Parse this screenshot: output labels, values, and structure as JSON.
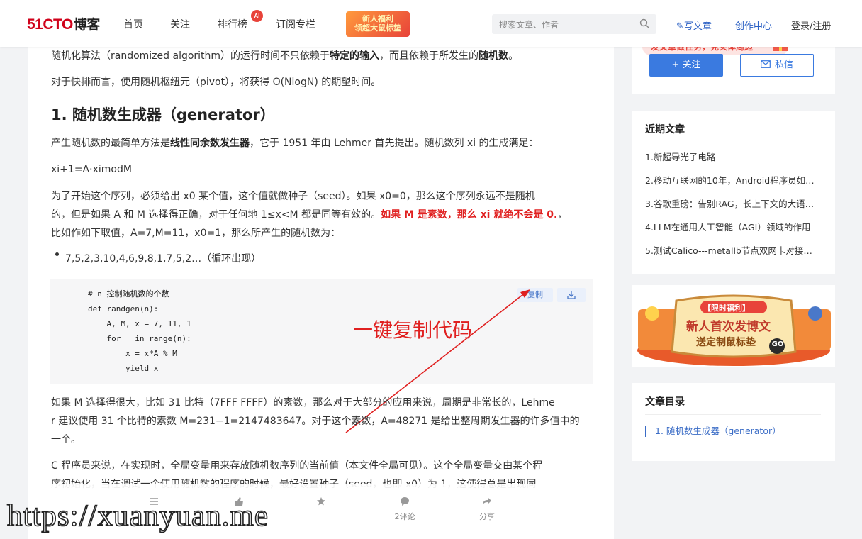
{
  "header": {
    "logo_main": "51CTO",
    "logo_sub": "博客",
    "nav": [
      "首页",
      "关注",
      "排行榜",
      "订阅专栏"
    ],
    "ai_badge": "AI",
    "promo_line1": "新人福利",
    "promo_line2": "领超大鼠标垫",
    "search_placeholder": "搜索文章、作者",
    "write_label": "写文章",
    "create_label": "创作中心",
    "login_label": "登录/注册"
  },
  "article": {
    "para_intro": [
      "随机化算法（randomized algorithm）的运行时间不只依赖于",
      "特定的输入",
      "，而且依赖于所发生的",
      "随机数",
      "。"
    ],
    "para_pivot": "对于快排而言，使用随机枢纽元（pivot），将获得 O(NlogN) 的期望时间。",
    "heading": "1. 随机数生成器（generator）",
    "para_lcg": [
      "产生随机数的最简单方法是",
      "线性同余数发生器",
      "，它于 1951 年由 Lehmer 首先提出。随机数列 xi 的生成满足："
    ],
    "formula": "xi+1=A·ximodM",
    "para_seed_1": "为了开始这个序列，必须给出 x0 某个值，这个值就做种子（seed）。如果 x0=0，那么这个序列永远不是随机",
    "para_seed_2a": "的，但是如果 A 和 M 选择得正确，对于任何地 1≤x<M 都是同等有效的。",
    "para_seed_2b": "如果 M 是素数，那么 xi 就绝不会是 0.",
    "para_seed_2c": "，",
    "para_seed_3": "比如作如下取值，A=7,M=11，x0=1，那么所产生的随机数为：",
    "bullet": "7,5,2,3,10,4,6,9,8,1,7,5,2…（循环出现）",
    "code": "# n 控制随机数的个数\ndef randgen(n):\n    A, M, x = 7, 11, 1\n    for _ in range(n):\n        x = x*A % M\n        yield x",
    "copy_label": "复制",
    "annotation": "一键复制代码",
    "para_m_1": "如果 M 选择得很大，比如 31 比特（7FFF FFFF）的素数，那么对于大部分的应用来说，周期是非常长的，Lehme",
    "para_m_2": "r 建议使用 31 个比特的素数 M=231−1=2147483647。对于这个素数，A=48271 是给出整周期发生器的许多值中的",
    "para_m_3": "一个。",
    "para_c_1": "C 程序员来说，在实现时，全局变量用来存放随机数序列的当前值（本文件全局可见）。这个全局变量交由某个程",
    "para_c_2": "序初始化，当在调试一个使用随机数的程序的时候，最好设置种子（seed，也即 x0）为 1，这使得总是出现同"
  },
  "bottom_bar": {
    "comment_label": "2评论",
    "share_label": "分享"
  },
  "watermark": "https://xuanyuan.me",
  "sidebar": {
    "task_banner": "发文章做任务，兑实体周边",
    "follow_label": "+ 关注",
    "message_label": "私信",
    "recent_title": "近期文章",
    "recent": [
      "1.新超导光子电路",
      "2.移动互联网的10年，Android程序员如何…",
      "3.谷歌重磅：告别RAG，长上下文的大语言…",
      "4.LLM在通用人工智能（AGI）领域的作用",
      "5.测试Calico---metallb节点双网卡对接…"
    ],
    "ad_tag": "【限时福利】",
    "ad_line1": "新人首次发博文",
    "ad_line2": "送定制鼠标垫",
    "ad_num": "GO",
    "toc_title": "文章目录",
    "toc_item": "1. 随机数生成器（generator）"
  },
  "colors": {
    "brand_red": "#d0021b",
    "link_blue": "#3a7ae0",
    "highlight_red": "#e02020"
  }
}
